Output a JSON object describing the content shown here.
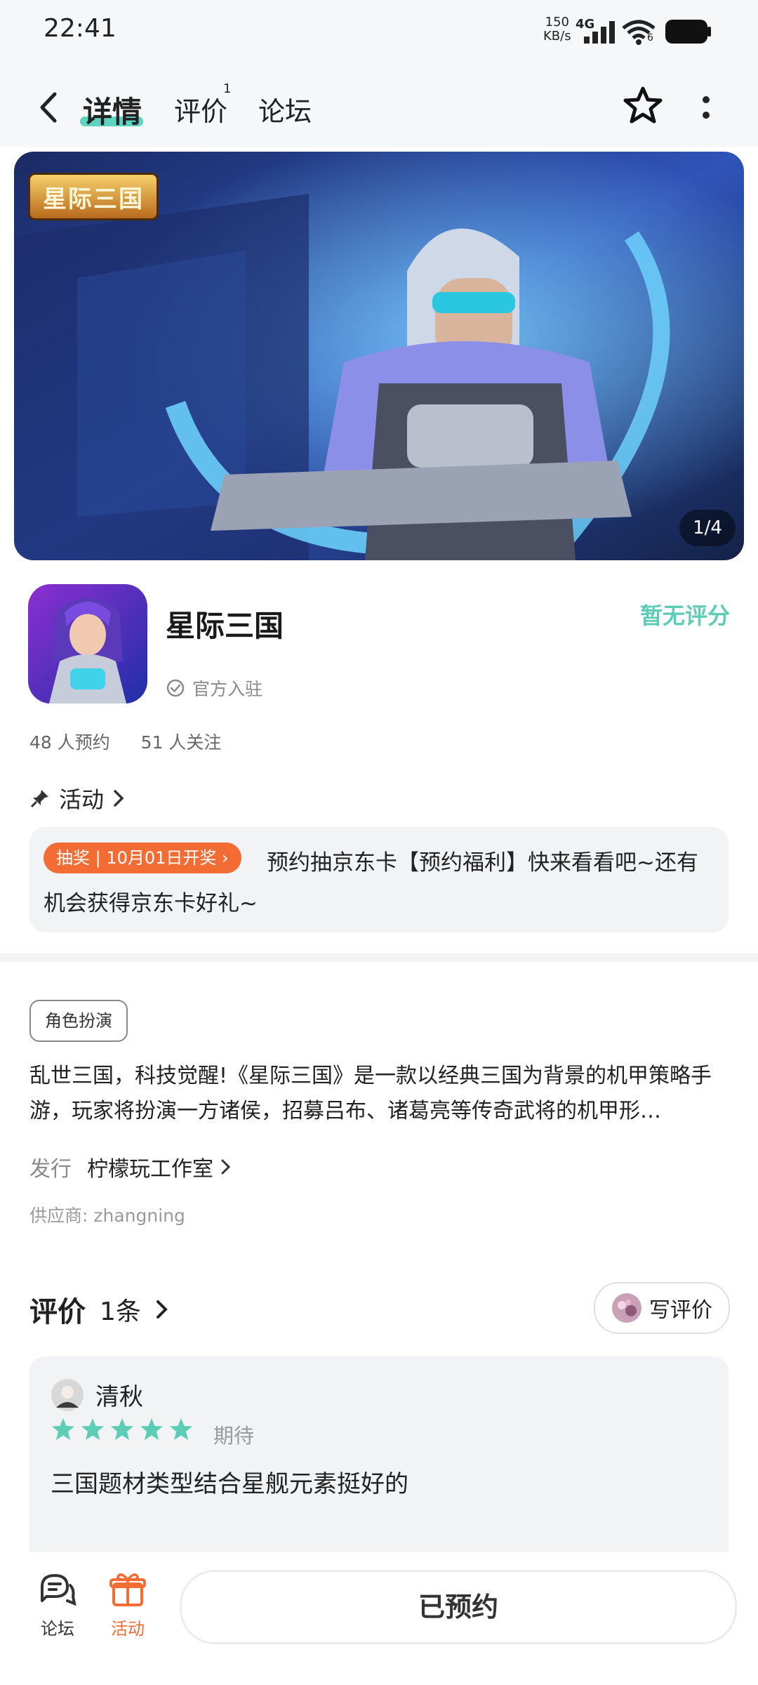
{
  "status_bar": {
    "time": "22:41",
    "net_speed_value": "150",
    "net_speed_unit": "KB/s",
    "network": "4G",
    "wifi_badge": "6"
  },
  "nav": {
    "tabs": [
      "详情",
      "评价",
      "论坛"
    ],
    "review_badge": "1",
    "icons": [
      "back-arrow-icon",
      "star-outline-icon",
      "more-vertical-icon"
    ]
  },
  "banner": {
    "logo_text": "星际三国",
    "pager": "1/4"
  },
  "game": {
    "title": "星际三国",
    "rating": "暂无评分",
    "official": "官方入驻",
    "reservations": "48 人预约",
    "follows": "51 人关注"
  },
  "activity": {
    "label": "活动",
    "tag": "抽奖 | 10月01日开奖 ›",
    "text": "预约抽京东卡【预约福利】快来看看吧~还有机会获得京东卡好礼~"
  },
  "details": {
    "genre": "角色扮演",
    "description": "乱世三国，科技觉醒!《星际三国》是一款以经典三国为背景的机甲策略手游，玩家将扮演一方诸侯，招募吕布、诸葛亮等传奇武将的机甲形…",
    "publisher_label": "发行",
    "publisher": "柠檬玩工作室",
    "supplier": "供应商: zhangning"
  },
  "reviews": {
    "title": "评价",
    "count": "1条",
    "write_label": "写评价",
    "items": [
      {
        "user": "清秋",
        "stars": 5,
        "tag": "期待",
        "text": "三国题材类型结合星舰元素挺好的"
      }
    ]
  },
  "bottom": {
    "forum_label": "论坛",
    "activity_label": "活动",
    "reserve_label": "已预约"
  },
  "colors": {
    "accent": "#5ecdb8",
    "orange": "#f26c33",
    "card_bg": "#f2f3f5"
  }
}
